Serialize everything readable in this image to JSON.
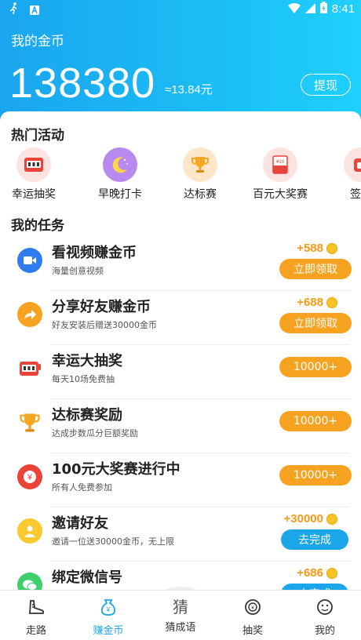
{
  "status_bar": {
    "time": "8:41"
  },
  "header": {
    "title": "我的金币",
    "balance": "138380",
    "approx_value": "≈13.84元",
    "withdraw_label": "提现"
  },
  "hot_activities": {
    "title": "热门活动",
    "items": [
      {
        "label": "幸运抽奖",
        "icon": "slot-machine-icon",
        "bg": "#fbe3e1"
      },
      {
        "label": "早晚打卡",
        "icon": "moon-icon",
        "bg": "#b889ee"
      },
      {
        "label": "达标赛",
        "icon": "trophy-icon",
        "bg": "#fde5c8"
      },
      {
        "label": "百元大奖赛",
        "icon": "red-envelope-icon",
        "bg": "#fbe3e1"
      },
      {
        "label": "签到",
        "icon": "calendar-icon",
        "bg": "#fbe3e1"
      }
    ]
  },
  "my_tasks": {
    "title": "我的任务",
    "items": [
      {
        "title": "看视频赚金币",
        "subtitle": "海量创意视频",
        "reward": "+588",
        "button": "立即领取",
        "button_color": "orange",
        "icon": "video-camera-icon"
      },
      {
        "title": "分享好友赚金币",
        "subtitle": "好友安装后赠送30000金币",
        "reward": "+688",
        "button": "立即领取",
        "button_color": "orange",
        "icon": "share-arrow-icon"
      },
      {
        "title": "幸运大抽奖",
        "subtitle": "每天10场免费抽",
        "reward": "",
        "button": "10000+",
        "button_color": "orange",
        "icon": "slot-machine-icon"
      },
      {
        "title": "达标赛奖励",
        "subtitle": "达成步数瓜分巨额奖励",
        "reward": "",
        "button": "10000+",
        "button_color": "orange",
        "icon": "trophy-icon"
      },
      {
        "title": "100元大奖赛进行中",
        "subtitle": "所有人免费参加",
        "reward": "",
        "button": "10000+",
        "button_color": "orange",
        "icon": "yen-coin-icon"
      },
      {
        "title": "邀请好友",
        "subtitle": "邀请一位送30000金币，无上限",
        "reward": "+30000",
        "button": "去完成",
        "button_color": "blue",
        "icon": "invite-user-icon"
      },
      {
        "title": "绑定微信号",
        "subtitle": "",
        "reward": "+686",
        "button": "去完成",
        "button_color": "blue",
        "icon": "wechat-icon"
      }
    ]
  },
  "tabbar": {
    "items": [
      {
        "label": "走路",
        "icon": "walking-shoe-icon"
      },
      {
        "label": "赚金币",
        "icon": "money-bag-icon",
        "active": true
      },
      {
        "label": "猜成语",
        "icon": "guess-character-icon",
        "glyph": "猜"
      },
      {
        "label": "抽奖",
        "icon": "lottery-icon"
      },
      {
        "label": "我的",
        "icon": "smiley-face-icon"
      }
    ]
  },
  "colors": {
    "header_start": "#1aa5ee",
    "header_end": "#1fd0fb",
    "accent_orange": "#f7a321",
    "accent_blue": "#1ba6ea",
    "reward_text": "#f39a18"
  }
}
